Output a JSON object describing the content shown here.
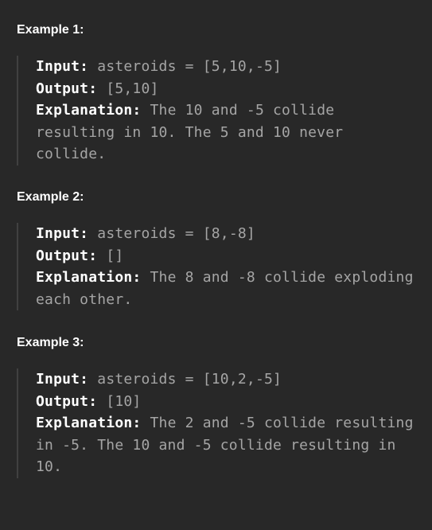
{
  "examples": [
    {
      "title": "Example 1:",
      "input_label": "Input:",
      "input_value": "asteroids = [5,10,-5]",
      "output_label": "Output:",
      "output_value": "[5,10]",
      "explanation_label": "Explanation:",
      "explanation_value": "The 10 and -5 collide resulting in 10. The 5 and 10 never collide."
    },
    {
      "title": "Example 2:",
      "input_label": "Input:",
      "input_value": "asteroids = [8,-8]",
      "output_label": "Output:",
      "output_value": "[]",
      "explanation_label": "Explanation:",
      "explanation_value": "The 8 and -8 collide exploding each other."
    },
    {
      "title": "Example 3:",
      "input_label": "Input:",
      "input_value": "asteroids = [10,2,-5]",
      "output_label": "Output:",
      "output_value": "[10]",
      "explanation_label": "Explanation:",
      "explanation_value": "The 2 and -5 collide resulting in -5. The 10 and -5 collide resulting in 10."
    }
  ]
}
